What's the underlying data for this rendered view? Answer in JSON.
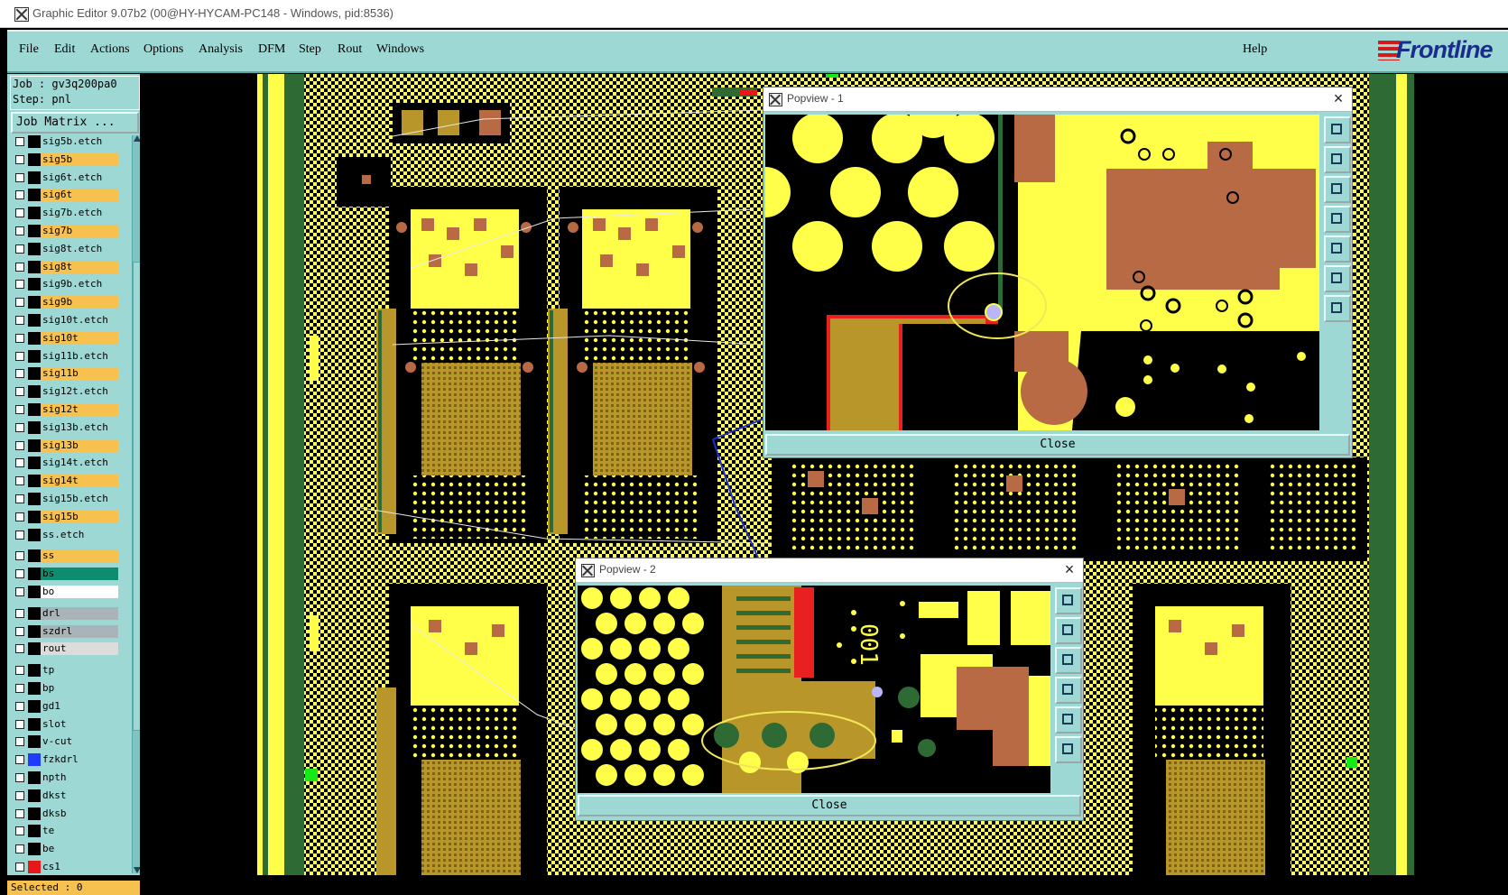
{
  "window": {
    "title": "Graphic Editor 9.07b2 (00@HY-HYCAM-PC148 - Windows, pid:8536)"
  },
  "menu": {
    "items": [
      "File",
      "Edit",
      "Actions",
      "Options",
      "Analysis",
      "DFM",
      "Step",
      "Rout",
      "Windows"
    ],
    "help": "Help",
    "logo": "Frontline"
  },
  "job": {
    "job_line": "Job : gv3q200pa0",
    "step_line": "Step: pnl",
    "matrix_button": "Job Matrix ..."
  },
  "layers": [
    {
      "name": "sig5b.etch",
      "color": "#9dd8d5",
      "swatch": "#000000"
    },
    {
      "name": "sig5b",
      "color": "#f6c14f",
      "swatch": "#000000"
    },
    {
      "name": "sig6t.etch",
      "color": "#9dd8d5",
      "swatch": "#000000"
    },
    {
      "name": "sig6t",
      "color": "#f6c14f",
      "swatch": "#000000"
    },
    {
      "name": "sig7b.etch",
      "color": "#9dd8d5",
      "swatch": "#000000"
    },
    {
      "name": "sig7b",
      "color": "#f6c14f",
      "swatch": "#000000"
    },
    {
      "name": "sig8t.etch",
      "color": "#9dd8d5",
      "swatch": "#000000"
    },
    {
      "name": "sig8t",
      "color": "#f6c14f",
      "swatch": "#000000"
    },
    {
      "name": "sig9b.etch",
      "color": "#9dd8d5",
      "swatch": "#000000"
    },
    {
      "name": "sig9b",
      "color": "#f6c14f",
      "swatch": "#000000"
    },
    {
      "name": "sig10t.etch",
      "color": "#9dd8d5",
      "swatch": "#000000"
    },
    {
      "name": "sig10t",
      "color": "#f6c14f",
      "swatch": "#000000"
    },
    {
      "name": "sig11b.etch",
      "color": "#9dd8d5",
      "swatch": "#000000"
    },
    {
      "name": "sig11b",
      "color": "#f6c14f",
      "swatch": "#000000"
    },
    {
      "name": "sig12t.etch",
      "color": "#9dd8d5",
      "swatch": "#000000"
    },
    {
      "name": "sig12t",
      "color": "#f6c14f",
      "swatch": "#000000"
    },
    {
      "name": "sig13b.etch",
      "color": "#9dd8d5",
      "swatch": "#000000"
    },
    {
      "name": "sig13b",
      "color": "#f6c14f",
      "swatch": "#000000"
    },
    {
      "name": "sig14t.etch",
      "color": "#9dd8d5",
      "swatch": "#000000"
    },
    {
      "name": "sig14t",
      "color": "#f6c14f",
      "swatch": "#000000"
    },
    {
      "name": "sig15b.etch",
      "color": "#9dd8d5",
      "swatch": "#000000"
    },
    {
      "name": "sig15b",
      "color": "#f6c14f",
      "swatch": "#000000"
    },
    {
      "name": "ss.etch",
      "color": "#9dd8d5",
      "swatch": "#000000"
    },
    {
      "name": "ss",
      "color": "#f6c14f",
      "swatch": "#000000"
    },
    {
      "name": "bs",
      "color": "#0d8c70",
      "swatch": "#000000"
    },
    {
      "name": "bo",
      "color": "#ffffff",
      "swatch": "#000000"
    },
    {
      "name": "drl",
      "color": "#a8b4b8",
      "swatch": "#000000"
    },
    {
      "name": "szdrl",
      "color": "#a8b4b8",
      "swatch": "#000000"
    },
    {
      "name": "rout",
      "color": "#dcdcdc",
      "swatch": "#000000"
    },
    {
      "name": "tp",
      "color": "#9dd8d5",
      "swatch": "#000000"
    },
    {
      "name": "bp",
      "color": "#9dd8d5",
      "swatch": "#000000"
    },
    {
      "name": "gd1",
      "color": "#9dd8d5",
      "swatch": "#000000"
    },
    {
      "name": "slot",
      "color": "#9dd8d5",
      "swatch": "#000000"
    },
    {
      "name": "v-cut",
      "color": "#9dd8d5",
      "swatch": "#000000"
    },
    {
      "name": "fzkdrl",
      "color": "#9dd8d5",
      "swatch": "#1e3cff"
    },
    {
      "name": "npth",
      "color": "#9dd8d5",
      "swatch": "#000000"
    },
    {
      "name": "dkst",
      "color": "#9dd8d5",
      "swatch": "#000000"
    },
    {
      "name": "dksb",
      "color": "#9dd8d5",
      "swatch": "#000000"
    },
    {
      "name": "te",
      "color": "#9dd8d5",
      "swatch": "#000000"
    },
    {
      "name": "be",
      "color": "#9dd8d5",
      "swatch": "#000000"
    },
    {
      "name": "cs1",
      "color": "#9dd8d5",
      "swatch": "#e81818"
    }
  ],
  "status": {
    "selected": "Selected : 0"
  },
  "popview1": {
    "title": "Popview - 1",
    "close_label": "Close"
  },
  "popview2": {
    "title": "Popview - 2",
    "close_label": "Close",
    "board_text": "001"
  },
  "colors": {
    "panel": "#9dd8d5",
    "copper": "#ffff4a",
    "dark_copper": "#b8962a",
    "pad_brown": "#b86a44",
    "highlight_layer": "#f6c14f",
    "board_green": "#2e6a34"
  }
}
